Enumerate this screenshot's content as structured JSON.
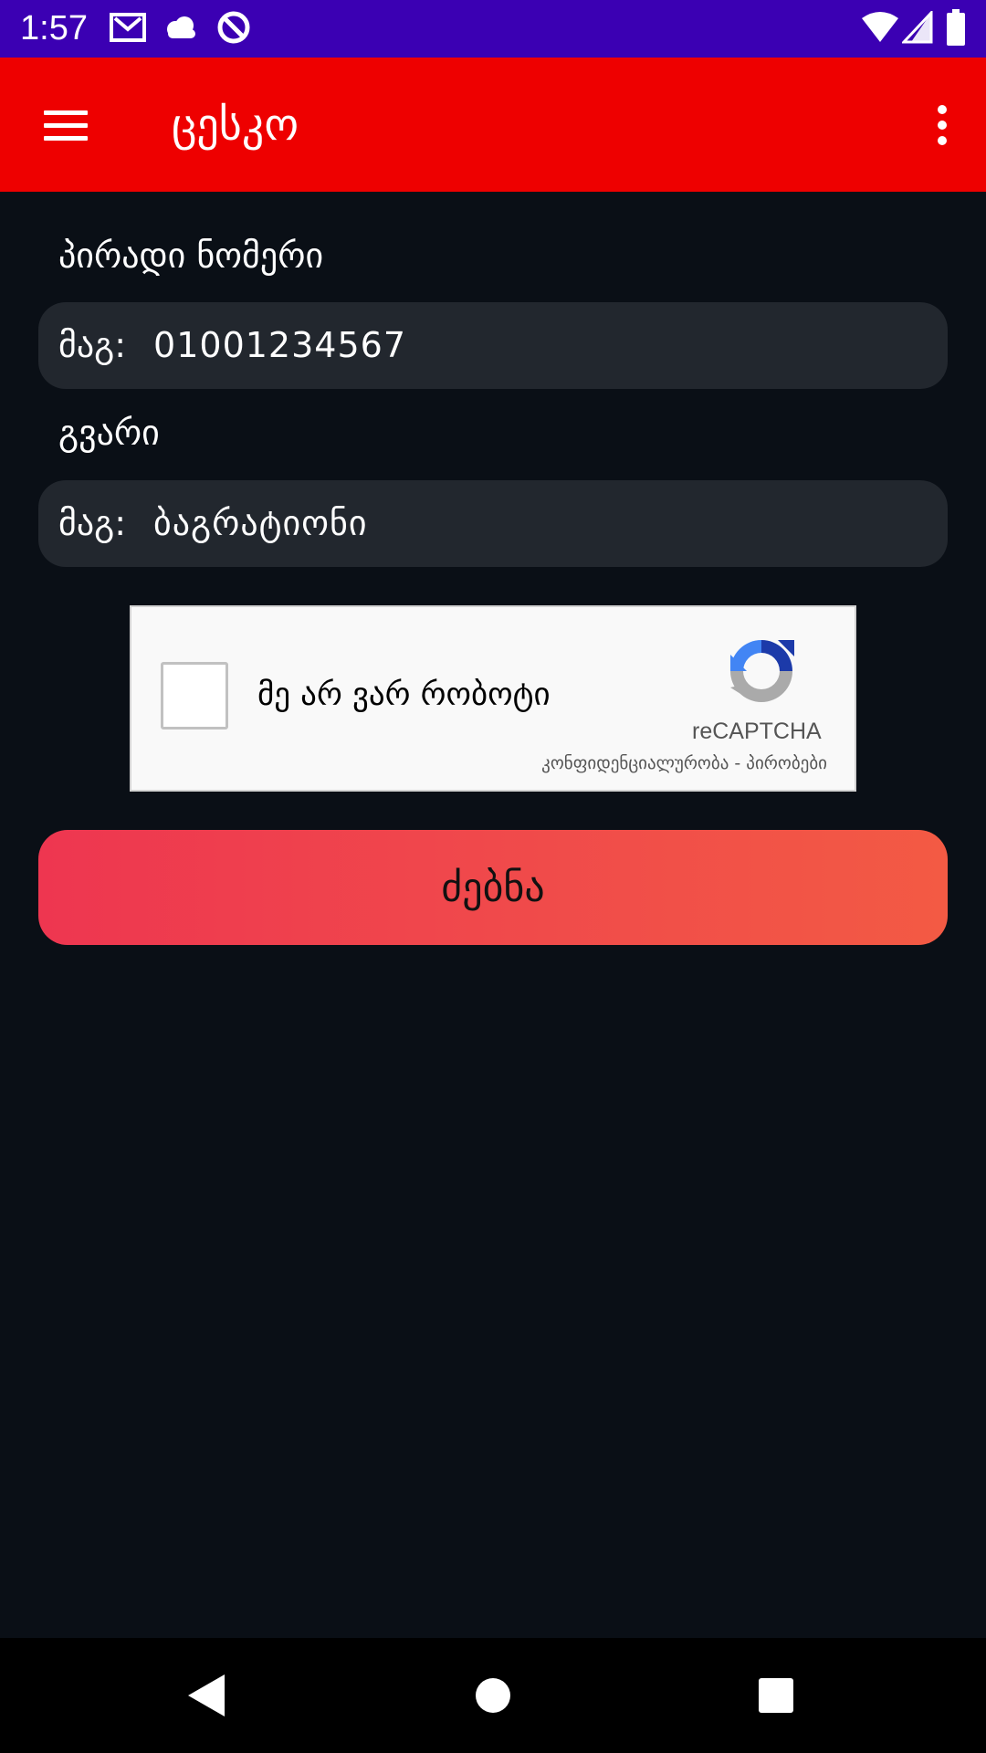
{
  "status_bar": {
    "time": "1:57",
    "icons": [
      "gmail-icon",
      "cloud-icon",
      "vpn-icon",
      "wifi-icon",
      "signal-icon",
      "battery-icon"
    ]
  },
  "app_bar": {
    "title": "ცესკო",
    "color": "#ee0000"
  },
  "form": {
    "personal_number": {
      "label": "პირადი ნომერი",
      "prefix": "მაგ:",
      "placeholder": "01001234567"
    },
    "surname": {
      "label": "გვარი",
      "prefix": "მაგ:",
      "placeholder": "ბაგრატიონი"
    }
  },
  "recaptcha": {
    "label": "მე არ ვარ რობოტი",
    "brand": "reCAPTCHA",
    "privacy_link": "კონფიდენციალურობა",
    "separator": " - ",
    "terms_link": "პირობები"
  },
  "search_button": {
    "label": "ძებნა"
  },
  "nav_bar": {
    "icons": [
      "back-icon",
      "home-icon",
      "recents-icon"
    ]
  }
}
